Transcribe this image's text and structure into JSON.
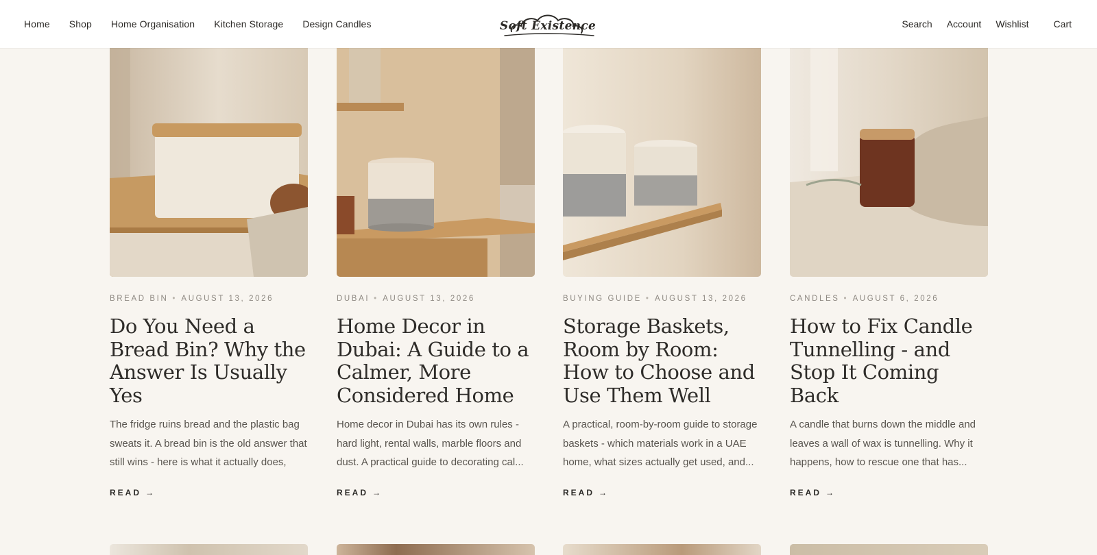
{
  "header": {
    "nav_left": [
      "Home",
      "Shop",
      "Home Organisation",
      "Kitchen Storage",
      "Design Candles"
    ],
    "logo_text": "Soft Existence",
    "nav_right": {
      "search": "Search",
      "account": "Account",
      "wishlist": "Wishlist",
      "cart": "Cart"
    }
  },
  "posts": [
    {
      "category": "Bread Bin",
      "date": "August 13, 2026",
      "title": "Do You Need a Bread Bin? Why the Answer Is Usually Yes",
      "excerpt": "The fridge ruins bread and the plastic bag sweats it. A bread bin is the old answer that still wins - here is what it actually does, an...",
      "read_label": "READ",
      "arrow": "→"
    },
    {
      "category": "Dubai",
      "date": "August 13, 2026",
      "title": "Home Decor in Dubai: A Guide to a Calmer, More Considered Home",
      "excerpt": "Home decor in Dubai has its own rules - hard light, rental walls, marble floors and dust. A practical guide to decorating cal...",
      "read_label": "READ",
      "arrow": "→"
    },
    {
      "category": "Buying Guide",
      "date": "August 13, 2026",
      "title": "Storage Baskets, Room by Room: How to Choose and Use Them Well",
      "excerpt": "A practical, room-by-room guide to storage baskets - which materials work in a UAE home, what sizes actually get used, and...",
      "read_label": "READ",
      "arrow": "→"
    },
    {
      "category": "Candles",
      "date": "August 6, 2026",
      "title": "How to Fix Candle Tunnelling - and Stop It Coming Back",
      "excerpt": "A candle that burns down the middle and leaves a wall of wax is tunnelling. Why it happens, how to rescue one that has...",
      "read_label": "READ",
      "arrow": "→"
    }
  ],
  "colors": {
    "background": "#f8f5f0",
    "header_bg": "#ffffff",
    "text": "#2c2a27",
    "meta": "#8f8a83"
  }
}
